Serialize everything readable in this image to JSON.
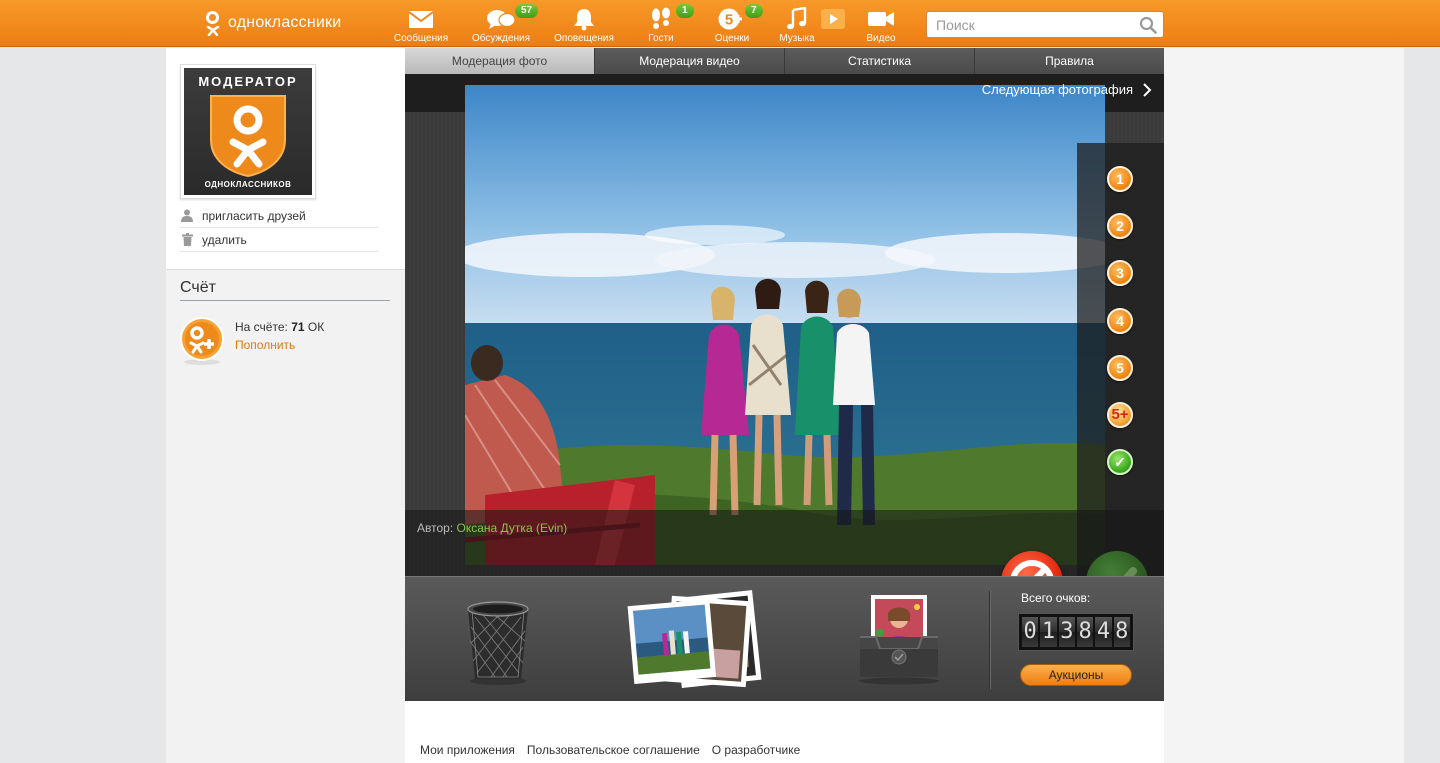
{
  "header": {
    "logo_text": "одноклассники",
    "nav": [
      {
        "label": "Сообщения",
        "icon": "envelope-icon",
        "badge": ""
      },
      {
        "label": "Обсуждения",
        "icon": "chat-bubbles-icon",
        "badge": "57"
      },
      {
        "label": "Оповещения",
        "icon": "bell-icon",
        "badge": ""
      },
      {
        "label": "Гости",
        "icon": "footprints-icon",
        "badge": "1"
      },
      {
        "label": "Оценки",
        "icon": "rating-5-icon",
        "badge": "7"
      },
      {
        "label": "Музыка",
        "icon": "music-note-icon",
        "badge": ""
      },
      {
        "label": "Видео",
        "icon": "video-camera-icon",
        "badge": ""
      }
    ],
    "search_placeholder": "Поиск"
  },
  "sidebar": {
    "avatar_top_text": "МОДЕРАТОР",
    "avatar_bottom_text": "ОДНОКЛАССНИКОВ",
    "links": [
      {
        "label": "пригласить друзей",
        "icon": "person-icon"
      },
      {
        "label": "удалить",
        "icon": "trash-icon"
      }
    ],
    "score_title": "Счёт",
    "balance_prefix": "На счёте:",
    "balance_value": "71",
    "balance_currency": "ОК",
    "topup_label": "Пополнить"
  },
  "tabs": [
    "Модерация фото",
    "Модерация видео",
    "Статистика",
    "Правила"
  ],
  "active_tab": 0,
  "viewer": {
    "next_label": "Следующая фотография",
    "ratings": [
      "1",
      "2",
      "3",
      "4",
      "5",
      "5+",
      "✓"
    ],
    "author_prefix": "Автор:",
    "author_name": "Оксана Дутка (Evin)"
  },
  "tray": {
    "score_label": "Всего очков:",
    "score_digits": [
      "0",
      "1",
      "3",
      "8",
      "4",
      "8"
    ],
    "auction_label": "Аукционы"
  },
  "footer": {
    "links": [
      "Мои приложения",
      "Пользовательское соглашение",
      "О разработчике"
    ]
  },
  "colors": {
    "brand_orange": "#ee7d12",
    "badge_green": "#4aa61c",
    "link_orange": "#e07a10",
    "author_green": "#8bc34a"
  }
}
